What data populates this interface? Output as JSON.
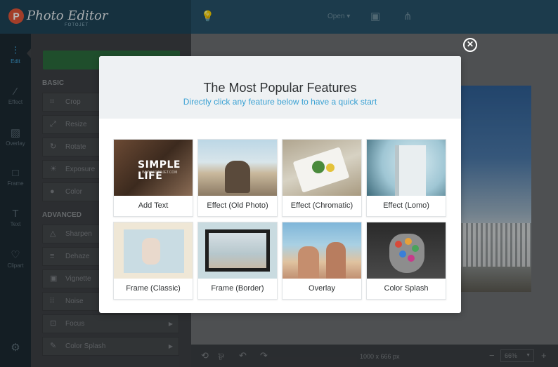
{
  "app": {
    "logo_letter": "P",
    "name": "Photo Editor",
    "sub": "FOTOJET"
  },
  "topbar": {
    "open_label": "Open ▾"
  },
  "leftnav": [
    {
      "label": "Edit",
      "icon": "sliders-icon"
    },
    {
      "label": "Effect",
      "icon": "magic-wand-icon"
    },
    {
      "label": "Overlay",
      "icon": "overlay-icon"
    },
    {
      "label": "Frame",
      "icon": "frame-icon"
    },
    {
      "label": "Text",
      "icon": "text-icon"
    },
    {
      "label": "Clipart",
      "icon": "heart-icon"
    }
  ],
  "sidebar": {
    "basic_title": "BASIC",
    "advanced_title": "ADVANCED",
    "basic_tools": [
      "Crop",
      "Resize",
      "Rotate",
      "Exposure",
      "Color"
    ],
    "advanced_tools": [
      "Sharpen",
      "Dehaze",
      "Vignette",
      "Noise",
      "Focus",
      "Color Splash"
    ]
  },
  "bottombar": {
    "dimensions": "1000 x 666 px",
    "zoom": "66%",
    "minus": "−",
    "plus": "+"
  },
  "modal": {
    "title": "The Most Popular Features",
    "subtitle": "Directly click any feature below to have a quick start",
    "cards": [
      {
        "label": "Add Text",
        "thumb_text": "SIMPLE LIFE",
        "thumb_sub": "WWW.FOTOJET.COM"
      },
      {
        "label": "Effect (Old Photo)"
      },
      {
        "label": "Effect (Chromatic)"
      },
      {
        "label": "Effect (Lomo)"
      },
      {
        "label": "Frame (Classic)"
      },
      {
        "label": "Frame (Border)"
      },
      {
        "label": "Overlay"
      },
      {
        "label": "Color Splash"
      }
    ]
  },
  "colors": {
    "accent": "#3aa1d3",
    "topbar": "#27536a",
    "apply_button": "#2b6c3d"
  }
}
